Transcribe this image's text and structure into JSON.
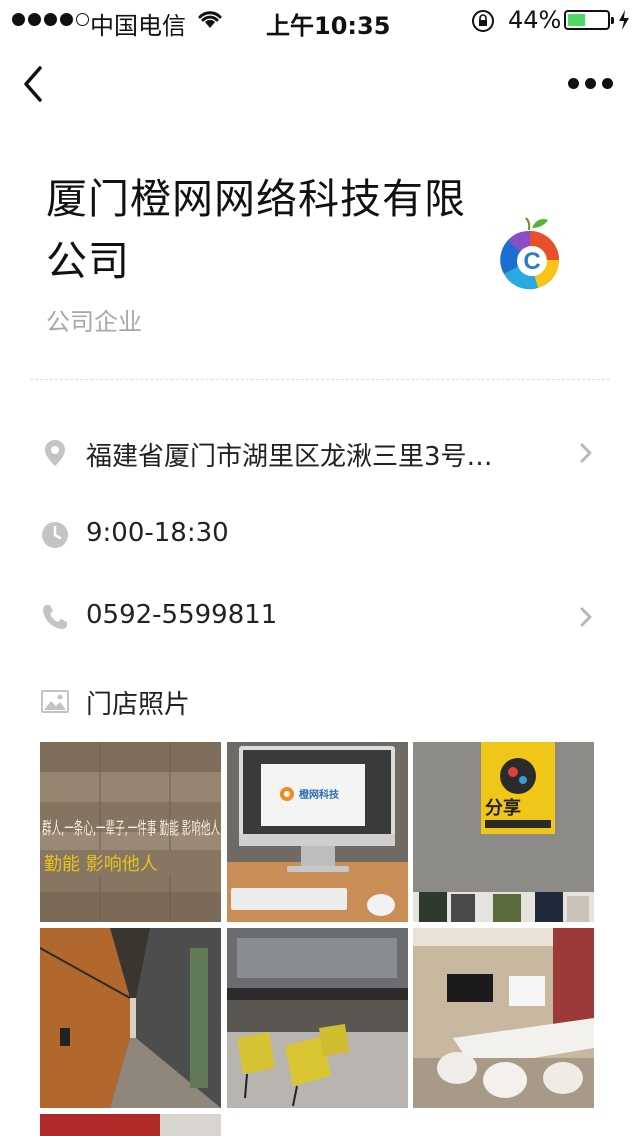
{
  "status_bar": {
    "carrier": "中国电信",
    "time": "上午10:35",
    "battery_percent": "44%",
    "battery_level": 0.44,
    "signal_bars": 4,
    "signal_total": 5
  },
  "nav": {
    "back_icon": "chevron-left-icon",
    "more_icon": "ellipsis-icon"
  },
  "store": {
    "name": "厦门橙网网络科技有限公司",
    "category": "公司企业",
    "logo_letter": "C"
  },
  "info": {
    "address": "福建省厦门市湖里区龙湫三里3号…",
    "hours": "9:00-18:30",
    "phone": "0592-5599811",
    "photos_heading": "门店照片"
  },
  "photos": [
    {
      "name": "photo-wood-wall",
      "text": "群人,一条心,一辈子,一件事  勤能  影响他人"
    },
    {
      "name": "photo-imac-desk",
      "text": "橙网科技"
    },
    {
      "name": "photo-poster-books",
      "text": "分享"
    },
    {
      "name": "photo-corridor"
    },
    {
      "name": "photo-lounge"
    },
    {
      "name": "photo-meeting-room"
    },
    {
      "name": "photo-partial"
    }
  ],
  "colors": {
    "accent_battery": "#4cd964",
    "muted_text": "#a8a8a8",
    "icon_gray": "#c4c4c4"
  }
}
